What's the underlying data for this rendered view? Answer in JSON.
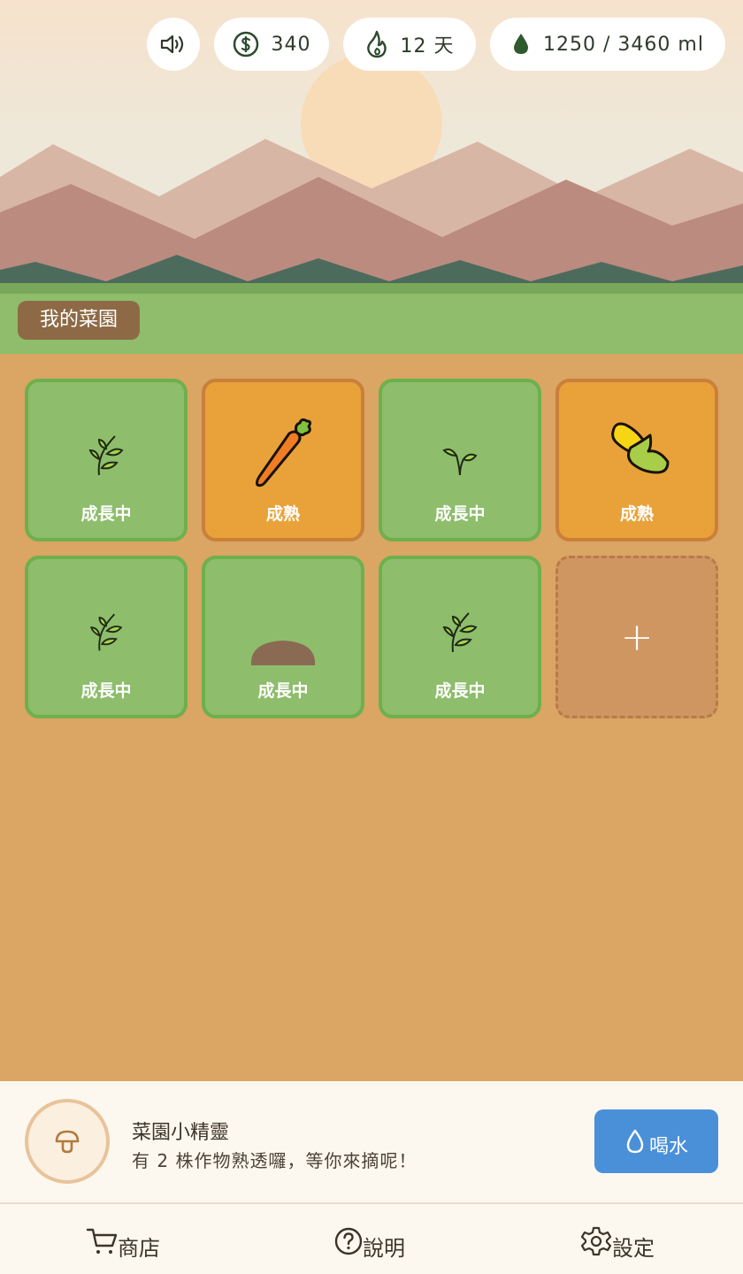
{
  "header": {
    "sound_icon": "speaker-icon",
    "coins": "340",
    "coin_icon": "dollar-coin-icon",
    "streak_label": "12 天",
    "streak_icon": "flame-icon",
    "water_label": "1250 / 3460 ml",
    "water_icon": "water-drop-icon"
  },
  "garden": {
    "title": "我的菜園",
    "plots": [
      {
        "status": "成長中",
        "plant_icon": "seedling-leaves-icon",
        "ripe": false
      },
      {
        "status": "成熟",
        "plant_icon": "carrot-icon",
        "ripe": true
      },
      {
        "status": "成長中",
        "plant_icon": "sprout-icon",
        "ripe": false
      },
      {
        "status": "成熟",
        "plant_icon": "corn-icon",
        "ripe": true
      },
      {
        "status": "成長中",
        "plant_icon": "seedling-leaves-icon",
        "ripe": false
      },
      {
        "status": "成長中",
        "plant_icon": "soil-mound-icon",
        "ripe": false
      },
      {
        "status": "成長中",
        "plant_icon": "seedling-leaves-icon",
        "ripe": false
      },
      {
        "status": "+",
        "plant_icon": "plus-icon",
        "ripe": false
      }
    ]
  },
  "fairy": {
    "avatar_icon": "mushroom-icon",
    "name": "菜園小精靈",
    "message": "有 2 株作物熟透囉，等你來摘呢！"
  },
  "drink_button": {
    "label": "喝水",
    "icon": "water-drop-outline-icon"
  },
  "nav": {
    "shop": {
      "label": "商店",
      "icon": "cart-icon"
    },
    "help": {
      "label": "說明",
      "icon": "question-circle-icon"
    },
    "settings": {
      "label": "設定",
      "icon": "gear-icon"
    }
  },
  "colors": {
    "soil": "#dba564",
    "plot_green": "#8ebd6c",
    "plot_ripe": "#e9a23a",
    "accent_blue": "#4a90d9"
  }
}
